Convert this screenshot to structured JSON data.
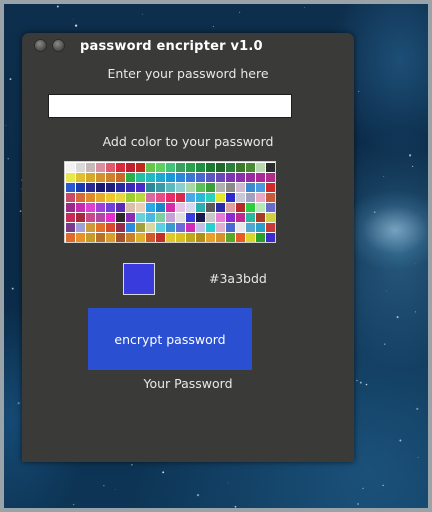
{
  "window": {
    "title": "password encripter v1.0",
    "buttons": [
      "close-button",
      "minimize-button"
    ]
  },
  "form": {
    "enter_label": "Enter your password here",
    "password_value": "",
    "color_label": "Add color to your password",
    "selected_color": "#3a3bdd",
    "selected_hex": "#3a3bdd",
    "encrypt_label": "encrypt password",
    "result_label": "Your Password"
  },
  "palette": {
    "columns": 21,
    "rows": 8,
    "colors": [
      "#f2f2f2",
      "#d9d9d9",
      "#c7b8b8",
      "#d98fa0",
      "#e05a6e",
      "#d82a3a",
      "#c01f2f",
      "#c02a1d",
      "#63c84a",
      "#5ed060",
      "#41c47a",
      "#3aa05e",
      "#2aa04a",
      "#1f8f44",
      "#1a7a30",
      "#1e6a2a",
      "#2c7e3c",
      "#3a7a2a",
      "#4a8a34",
      "#b8d8b0",
      "#2c2c2c",
      "#e8e84a",
      "#e0c030",
      "#d8a82a",
      "#d4922e",
      "#d0802a",
      "#c86a2a",
      "#2ab04a",
      "#24c0a0",
      "#22b8c0",
      "#1ea8d0",
      "#1a98d8",
      "#2a88d8",
      "#3a78d0",
      "#4a68c8",
      "#5a58c0",
      "#6a48b8",
      "#7a38b0",
      "#8a30a8",
      "#9a2aa0",
      "#a82a98",
      "#b02a8a",
      "#2a5ad0",
      "#1a3ab0",
      "#2a2a90",
      "#1a1a70",
      "#20207a",
      "#2a2aa0",
      "#3a2ab8",
      "#4a2ac8",
      "#2a8a9a",
      "#3a9aa8",
      "#5abac0",
      "#8ad0d0",
      "#a8d8a8",
      "#5ac05a",
      "#3aa03a",
      "#b0b0b0",
      "#8a8a8a",
      "#d0b8d0",
      "#3a8ad0",
      "#4a9ae0",
      "#d02a2a",
      "#c84a6a",
      "#d86a3a",
      "#e08a2a",
      "#e8aa2a",
      "#f0c82a",
      "#e8d840",
      "#9ad02a",
      "#b8d840",
      "#d86aa0",
      "#e84a8a",
      "#e82a6a",
      "#d82a4a",
      "#4aa8e8",
      "#2ab8d8",
      "#2ad0b8",
      "#e8e82a",
      "#2a2ad0",
      "#c8c8d8",
      "#a0a0c0",
      "#e8a8c8",
      "#c85a3a",
      "#9a2a8a",
      "#c82ab0",
      "#e040d0",
      "#a040d8",
      "#7040d8",
      "#5a2ab0",
      "#d8c0a8",
      "#e8d0b8",
      "#2aa8e8",
      "#1a88c8",
      "#d82aa8",
      "#e8c0e8",
      "#d8d8f0",
      "#2ab0b0",
      "#5a5a5a",
      "#2a2aa8",
      "#e0a0a0",
      "#b82a2a",
      "#2ad040",
      "#b8e8b8",
      "#6a6ac8",
      "#c82a5a",
      "#a82a3a",
      "#c84a8a",
      "#b04aa0",
      "#e82ad0",
      "#2a2a2a",
      "#8a2ab8",
      "#6ad0d8",
      "#4ab8e0",
      "#7ad0a0",
      "#c8a0d8",
      "#e0e0e0",
      "#3a3bdd",
      "#1a1a4a",
      "#c8c8c8",
      "#e87ad8",
      "#8a2ad0",
      "#c02a90",
      "#2ab8a0",
      "#a83a2a",
      "#d0d040",
      "#7a3a8a",
      "#a0a0d8",
      "#d09a3a",
      "#e0702a",
      "#d84a2a",
      "#9a2a4a",
      "#2a8ae0",
      "#a0a040",
      "#d8d8a0",
      "#5ad0e0",
      "#3a9ad0",
      "#6a6ad8",
      "#d02ab8",
      "#c0c0e8",
      "#2ad0d0",
      "#e0b0d0",
      "#4a6ad0",
      "#e8e8e8",
      "#50a8d0",
      "#2aa0c8",
      "#c83a3a",
      "#e06a2a",
      "#e8902a",
      "#c89a2a",
      "#b8702a",
      "#d8a02a",
      "#a8502a",
      "#c8802a",
      "#e0b02a",
      "#d05a2a",
      "#c0302a",
      "#e0c82a",
      "#d8c020",
      "#c0a81a",
      "#b0901a",
      "#e8a02a",
      "#d8902a",
      "#5aa82a",
      "#e85a2a",
      "#d8d82a",
      "#2aa02a",
      "#3a2ad0"
    ]
  }
}
